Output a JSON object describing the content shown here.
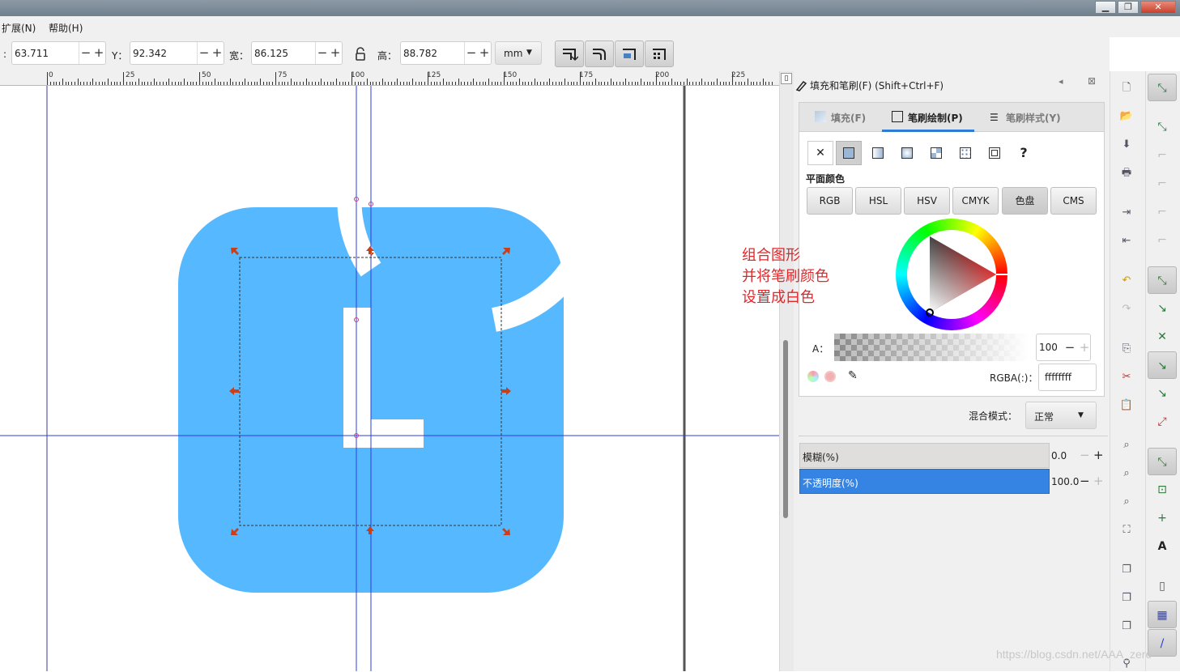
{
  "menu": {
    "items": [
      {
        "label": "扩展(N)"
      },
      {
        "label": "帮助(H)"
      }
    ]
  },
  "toolbar": {
    "x_value": "63.711",
    "y_label": "Y：",
    "y_value": "92.342",
    "w_label": "宽：",
    "w_value": "86.125",
    "h_label": "高：",
    "h_value": "88.782",
    "unit": "mm"
  },
  "ruler": {
    "labels": [
      "0",
      "25",
      "50",
      "75",
      "100",
      "125",
      "150",
      "175",
      "200",
      "225"
    ]
  },
  "dock": {
    "title": "填充和笔刷(F) (Shift+Ctrl+F)",
    "tabs": [
      {
        "label": "填充(F)"
      },
      {
        "label": "笔刷绘制(P)"
      },
      {
        "label": "笔刷样式(Y)"
      }
    ],
    "flat_color_label": "平面颜色",
    "color_modes": [
      "RGB",
      "HSL",
      "HSV",
      "CMYK",
      "色盘",
      "CMS"
    ],
    "alpha_label": "A：",
    "alpha_value": "100",
    "rgba_label": "RGBA(:)：",
    "rgba_value": "ffffffff",
    "blend_label": "混合模式：",
    "blend_value": "正常",
    "blur_label": "模糊(%)",
    "blur_value": "0.0",
    "opacity_label": "不透明度(%)",
    "opacity_value": "100.0"
  },
  "annotation": {
    "lines": [
      "组合图形",
      "并将笔刷颜色",
      "设置成白色"
    ]
  },
  "watermark": "https://blog.csdn.net/AAA_zero",
  "colors": {
    "icon_blue": "#56b9ff",
    "annotation_red": "#e0282b",
    "accent_blue": "#2f7cd6"
  }
}
